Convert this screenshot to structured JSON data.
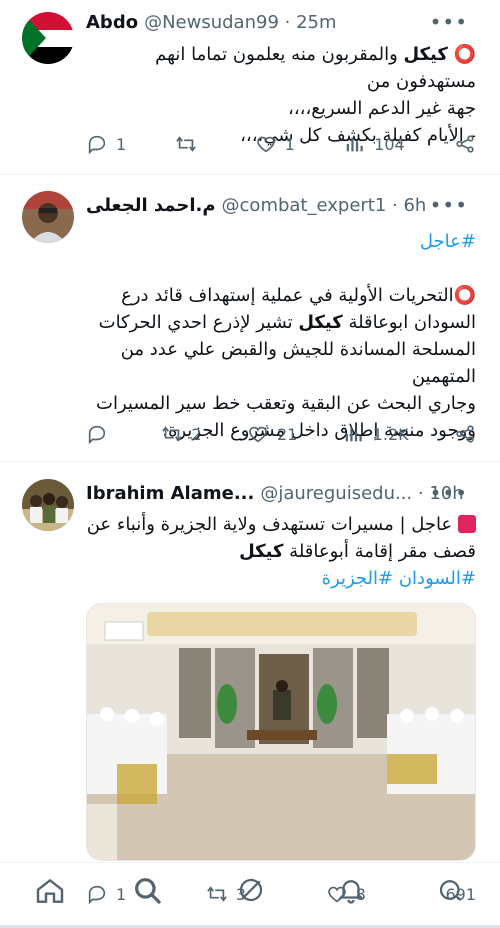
{
  "tweets": [
    {
      "name": "Abdo",
      "handle": "@Newsudan99",
      "time": "25m",
      "line1_bold": "كيكل",
      "line1_rest": " والمقربون منه يعلمون تماما انهم مستهدفون من",
      "line2": "جهة غير الدعم السريع،،،،",
      "line3": "- الأيام كفيلة بكشف كل شي،،،،",
      "replies": "1",
      "retweets": "",
      "likes": "1",
      "views": "104"
    },
    {
      "name": "م.احمد الجعلى",
      "handle": "@combat_expert1",
      "time": "6h",
      "hashtag": "#عاجل",
      "line1": "التحريات الأولية في عملية إستهداف قائد درع",
      "line2_pre": "السودان ابوعاقلة ",
      "line2_bold": "كيكل",
      "line2_post": " تشير لإذرع احدي الحركات",
      "line3": "المسلحة المساندة للجيش والقبض علي عدد من المتهمين",
      "line4": "وجاري البحث عن البقية وتعقب خط سير المسيرات",
      "line5": "ووجود منصة إطلاق داخل مشروع الجزيرة.",
      "replies": "",
      "retweets": "2",
      "likes": "21",
      "views": "1.2K"
    },
    {
      "name": "Ibrahim Alame...",
      "handle": "@jaureguisedu...",
      "time": "10h",
      "line1": "عاجل | مسيرات تستهدف ولاية الجزيرة وأنباء عن",
      "line2_pre": "قصف مقر إقامة أبوعاقلة ",
      "line2_bold": "كيكل",
      "hashtags": "#السودان #الجزيرة",
      "replies": "1",
      "retweets": "3",
      "likes": "8",
      "views": "691"
    }
  ],
  "colors": {
    "accent": "#1d9bf0",
    "muted": "#536471",
    "text": "#0f1419"
  }
}
